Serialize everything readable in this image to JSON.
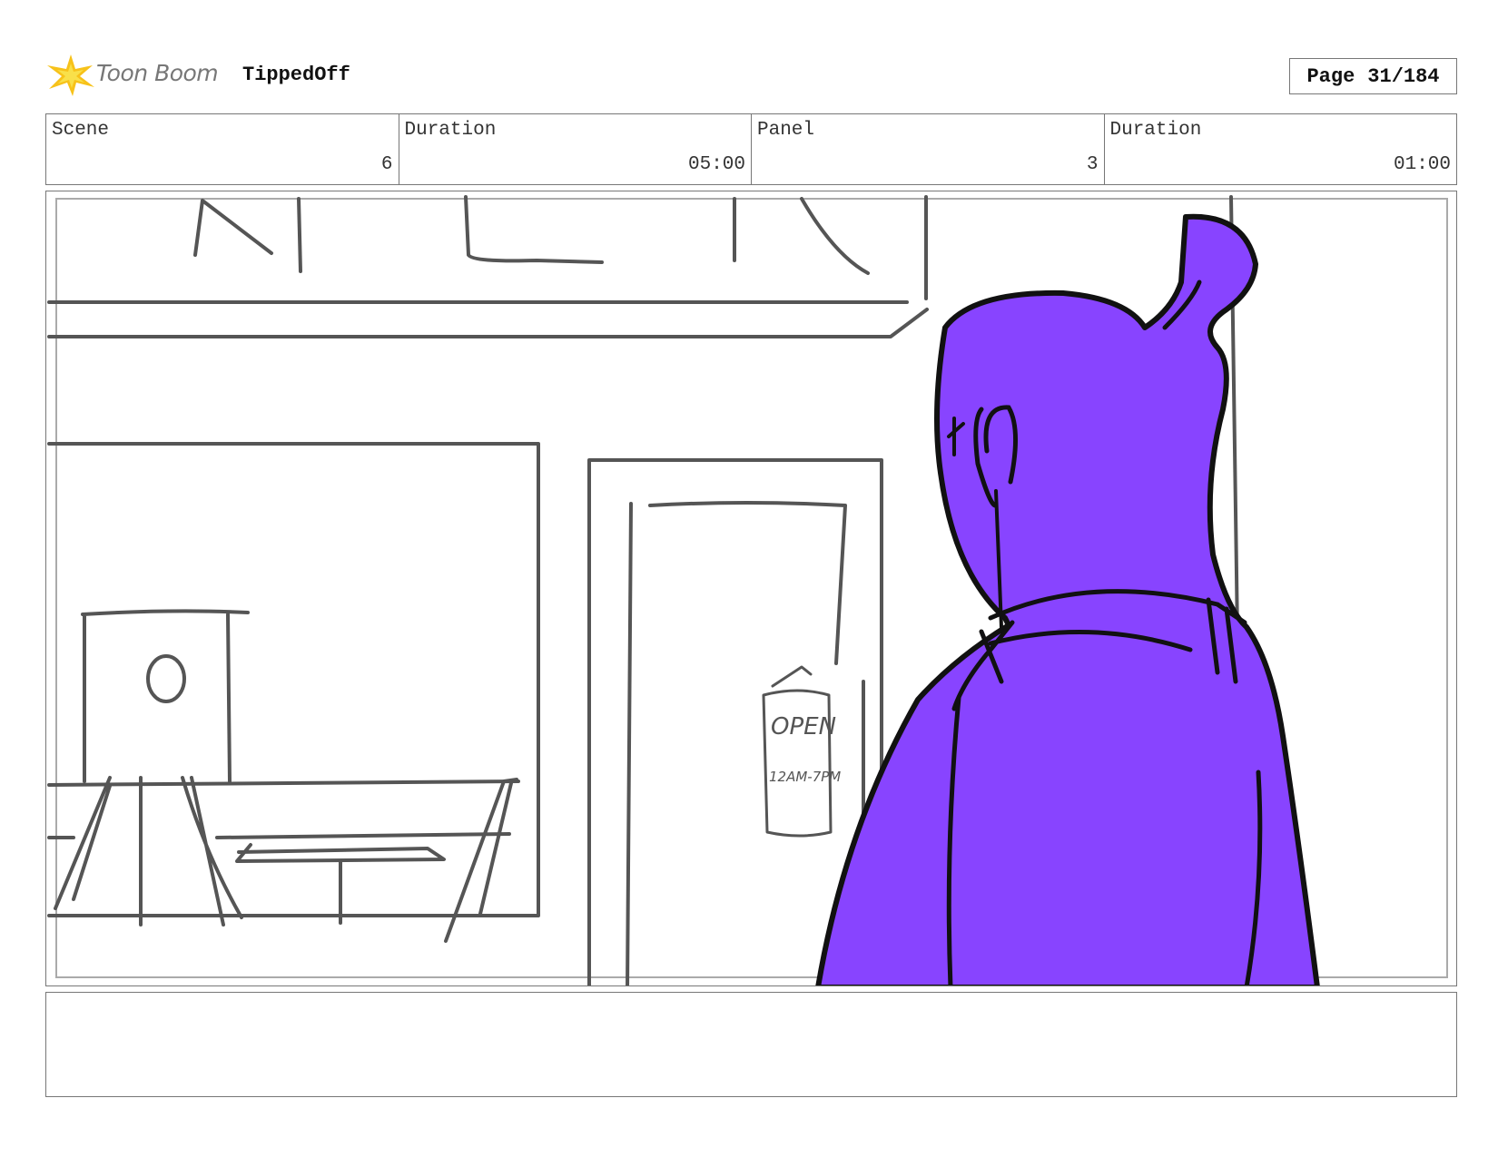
{
  "header": {
    "logo_text": "Toon Boom",
    "project_title": "TippedOff",
    "page_label": "Page",
    "page_number": "31/184"
  },
  "info": {
    "scene_label": "Scene",
    "scene_value": "6",
    "scene_duration_label": "Duration",
    "scene_duration_value": "05:00",
    "panel_label": "Panel",
    "panel_value": "3",
    "panel_duration_label": "Duration",
    "panel_duration_value": "01:00"
  },
  "sketch": {
    "sign_text_line1": "OPEN",
    "sign_text_line2": "12AM-7PM",
    "character_color": "#8844ff",
    "line_color": "#555555"
  },
  "caption": {
    "text": ""
  }
}
